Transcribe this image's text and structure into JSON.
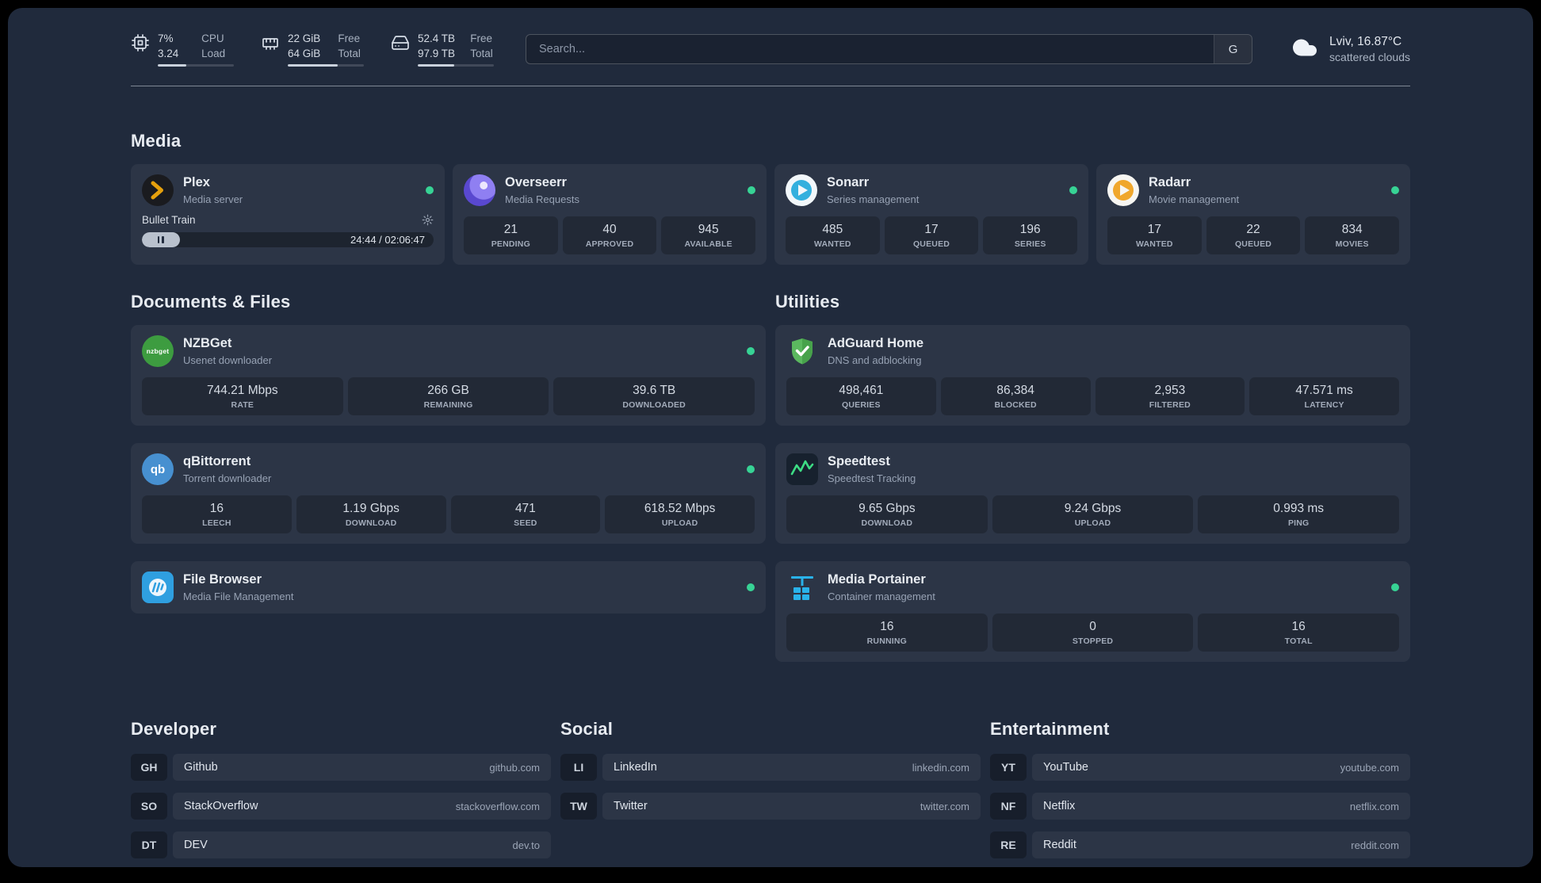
{
  "topbar": {
    "resources": [
      {
        "id": "cpu",
        "primary": "7%",
        "secondary": "3.24",
        "label_top": "CPU",
        "label_bottom": "Load",
        "progress_pct": 37
      },
      {
        "id": "memory",
        "primary": "22 GiB",
        "secondary": "64 GiB",
        "label_top": "Free",
        "label_bottom": "Total",
        "progress_pct": 66
      },
      {
        "id": "disk",
        "primary": "52.4 TB",
        "secondary": "97.9 TB",
        "label_top": "Free",
        "label_bottom": "Total",
        "progress_pct": 48
      }
    ],
    "search": {
      "placeholder": "Search...",
      "provider": "G"
    },
    "weather": {
      "location": "Lviv, 16.87°C",
      "condition": "scattered clouds"
    }
  },
  "groups": [
    {
      "title": "Media",
      "services": [
        {
          "name": "Plex",
          "desc": "Media server",
          "icon": "plex",
          "online": true,
          "player": {
            "track": "Bullet Train",
            "time": "24:44 / 02:06:47",
            "progress_pct": 13,
            "state": "paused"
          }
        },
        {
          "name": "Overseerr",
          "desc": "Media Requests",
          "icon": "overseerr",
          "online": true,
          "stats": [
            {
              "value": "21",
              "label": "PENDING"
            },
            {
              "value": "40",
              "label": "APPROVED"
            },
            {
              "value": "945",
              "label": "AVAILABLE"
            }
          ]
        },
        {
          "name": "Sonarr",
          "desc": "Series management",
          "icon": "sonarr",
          "online": true,
          "stats": [
            {
              "value": "485",
              "label": "WANTED"
            },
            {
              "value": "17",
              "label": "QUEUED"
            },
            {
              "value": "196",
              "label": "SERIES"
            }
          ]
        },
        {
          "name": "Radarr",
          "desc": "Movie management",
          "icon": "radarr",
          "online": true,
          "stats": [
            {
              "value": "17",
              "label": "WANTED"
            },
            {
              "value": "22",
              "label": "QUEUED"
            },
            {
              "value": "834",
              "label": "MOVIES"
            }
          ]
        }
      ]
    },
    {
      "title": "Documents & Files",
      "services": [
        {
          "name": "NZBGet",
          "desc": "Usenet downloader",
          "icon": "nzbget",
          "online": true,
          "stats": [
            {
              "value": "744.21 Mbps",
              "label": "RATE"
            },
            {
              "value": "266 GB",
              "label": "REMAINING"
            },
            {
              "value": "39.6 TB",
              "label": "DOWNLOADED"
            }
          ]
        },
        {
          "name": "qBittorrent",
          "desc": "Torrent downloader",
          "icon": "qbittorrent",
          "online": true,
          "stats": [
            {
              "value": "16",
              "label": "LEECH"
            },
            {
              "value": "1.19 Gbps",
              "label": "DOWNLOAD"
            },
            {
              "value": "471",
              "label": "SEED"
            },
            {
              "value": "618.52 Mbps",
              "label": "UPLOAD"
            }
          ]
        },
        {
          "name": "File Browser",
          "desc": "Media File Management",
          "icon": "filebrowser",
          "online": true
        }
      ]
    },
    {
      "title": "Utilities",
      "services": [
        {
          "name": "AdGuard Home",
          "desc": "DNS and adblocking",
          "icon": "adguard",
          "online": false,
          "stats": [
            {
              "value": "498,461",
              "label": "QUERIES"
            },
            {
              "value": "86,384",
              "label": "BLOCKED"
            },
            {
              "value": "2,953",
              "label": "FILTERED"
            },
            {
              "value": "47.571 ms",
              "label": "LATENCY"
            }
          ]
        },
        {
          "name": "Speedtest",
          "desc": "Speedtest Tracking",
          "icon": "speedtest",
          "online": false,
          "stats": [
            {
              "value": "9.65 Gbps",
              "label": "DOWNLOAD"
            },
            {
              "value": "9.24 Gbps",
              "label": "UPLOAD"
            },
            {
              "value": "0.993 ms",
              "label": "PING"
            }
          ]
        },
        {
          "name": "Media Portainer",
          "desc": "Container management",
          "icon": "portainer",
          "online": true,
          "stats": [
            {
              "value": "16",
              "label": "RUNNING"
            },
            {
              "value": "0",
              "label": "STOPPED"
            },
            {
              "value": "16",
              "label": "TOTAL"
            }
          ]
        }
      ]
    }
  ],
  "bookmarks": [
    {
      "title": "Developer",
      "items": [
        {
          "abbr": "GH",
          "name": "Github",
          "domain": "github.com"
        },
        {
          "abbr": "SO",
          "name": "StackOverflow",
          "domain": "stackoverflow.com"
        },
        {
          "abbr": "DT",
          "name": "DEV",
          "domain": "dev.to"
        }
      ]
    },
    {
      "title": "Social",
      "items": [
        {
          "abbr": "LI",
          "name": "LinkedIn",
          "domain": "linkedin.com"
        },
        {
          "abbr": "TW",
          "name": "Twitter",
          "domain": "twitter.com"
        }
      ]
    },
    {
      "title": "Entertainment",
      "items": [
        {
          "abbr": "YT",
          "name": "YouTube",
          "domain": "youtube.com"
        },
        {
          "abbr": "NF",
          "name": "Netflix",
          "domain": "netflix.com"
        },
        {
          "abbr": "RE",
          "name": "Reddit",
          "domain": "reddit.com"
        }
      ]
    }
  ],
  "colors": {
    "background": "#202a3c",
    "card": "#2b3547",
    "online_dot": "#37d395",
    "accent_plex": "#e5a00d",
    "accent_adguard": "#5bb85f",
    "accent_speedtest": "#3ddc84",
    "accent_portainer": "#29b2ea"
  }
}
